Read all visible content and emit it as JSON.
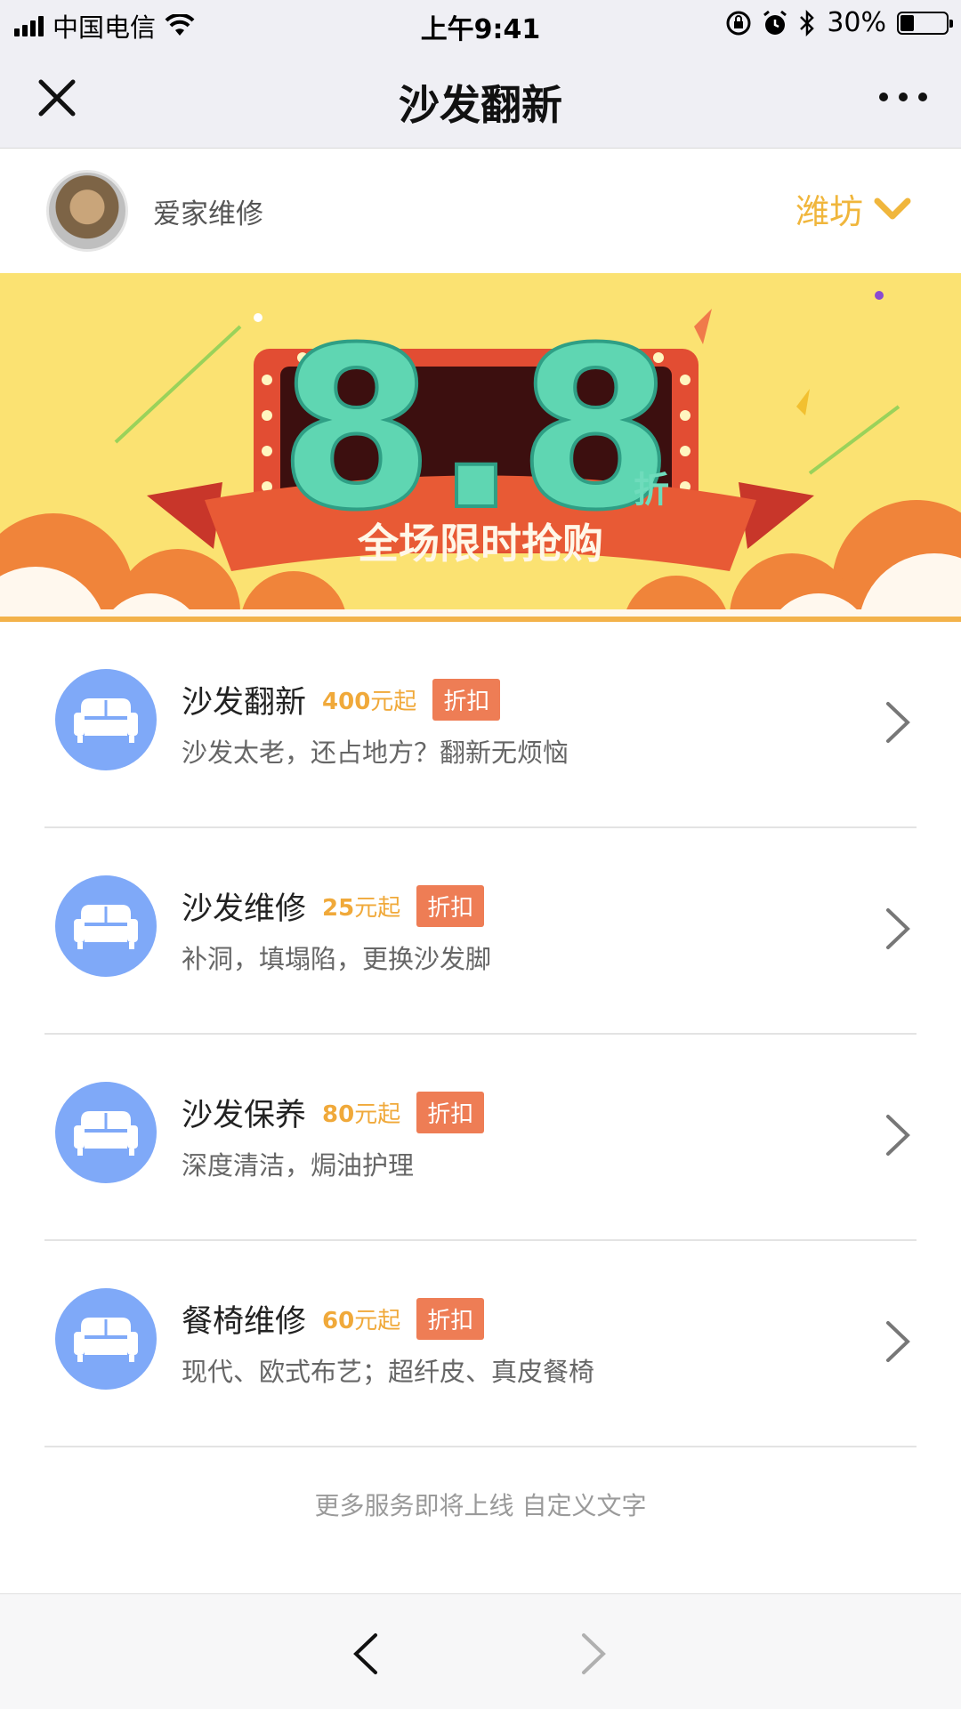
{
  "status_bar": {
    "carrier": "中国电信",
    "time": "上午9:41",
    "battery": "30%",
    "battery_level": 0.3
  },
  "nav": {
    "title": "沙发翻新",
    "close_icon": "close-icon",
    "more_icon": "more-icon"
  },
  "shop": {
    "name": "爱家维修",
    "city": "潍坊"
  },
  "banner": {
    "discount": "8.8",
    "unit": "折",
    "slogan": "全场限时抢购"
  },
  "services": [
    {
      "name": "沙发翻新",
      "price_number": "400",
      "price_suffix": "元起",
      "badge": "折扣",
      "desc": "沙发太老，还占地方？翻新无烦恼"
    },
    {
      "name": "沙发维修",
      "price_number": "25",
      "price_suffix": "元起",
      "badge": "折扣",
      "desc": "补洞，填塌陷，更换沙发脚"
    },
    {
      "name": "沙发保养",
      "price_number": "80",
      "price_suffix": "元起",
      "badge": "折扣",
      "desc": "深度清洁，焗油护理"
    },
    {
      "name": "餐椅维修",
      "price_number": "60",
      "price_suffix": "元起",
      "badge": "折扣",
      "desc": "现代、欧式布艺；超纤皮、真皮餐椅"
    }
  ],
  "footer_note": "更多服务即将上线 自定义文字",
  "colors": {
    "accent_yellow": "#f0b63c",
    "badge_orange": "#ee7d55",
    "icon_blue": "#7fa9f8",
    "banner_bg": "#fbe272"
  }
}
